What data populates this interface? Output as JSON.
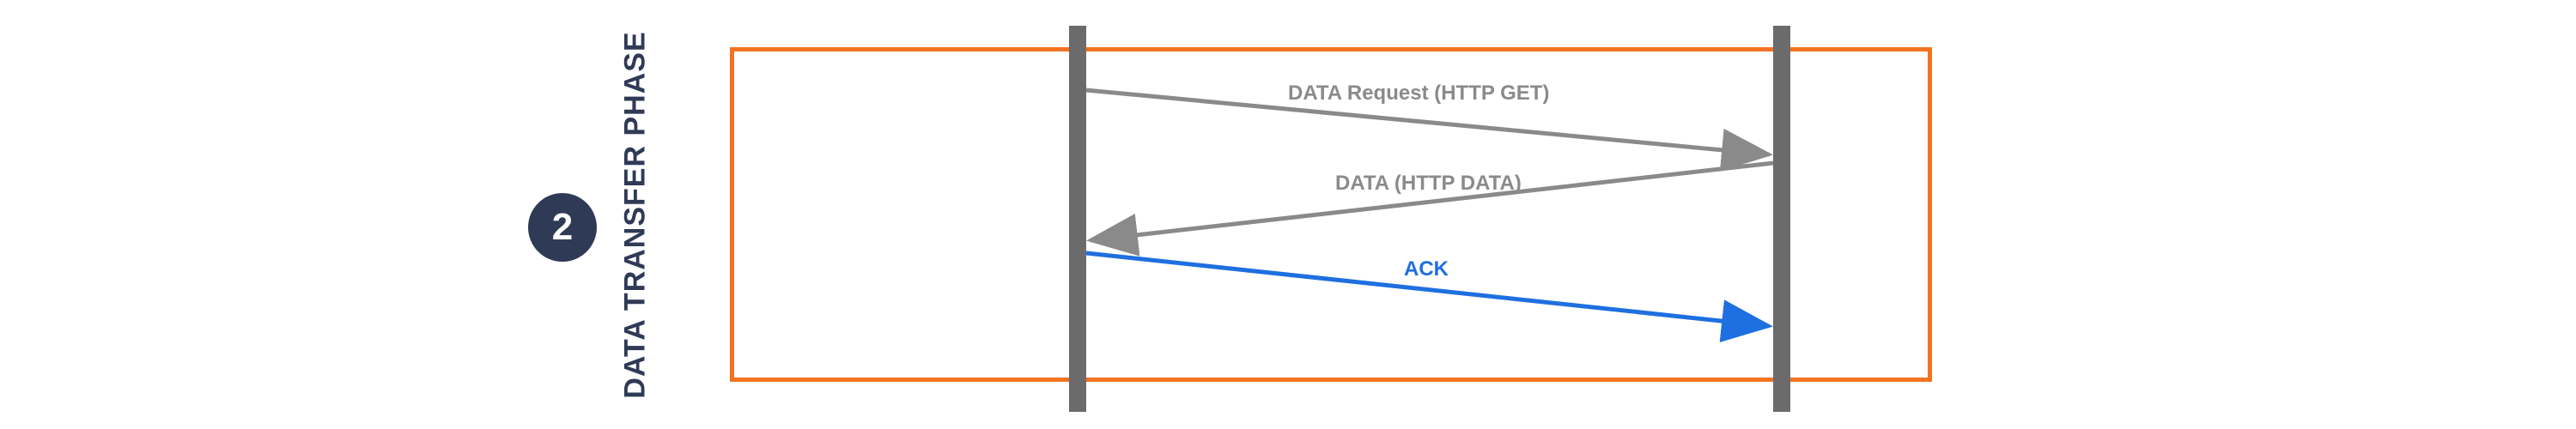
{
  "phase": {
    "number": "2",
    "title": "DATA TRANSFER PHASE"
  },
  "messages": {
    "req": "DATA Request (HTTP GET)",
    "resp": "DATA (HTTP DATA)",
    "ack": "ACK"
  },
  "colors": {
    "badge_bg": "#2F3A56",
    "panel_border": "#F37321",
    "lifeline": "#6B6B6B",
    "grey_arrow": "#8A8A8A",
    "blue_arrow": "#1E6FE0"
  },
  "chart_data": {
    "type": "sequence-diagram",
    "title": "DATA TRANSFER PHASE",
    "lifelines": [
      "left",
      "right"
    ],
    "messages": [
      {
        "from": "left",
        "to": "right",
        "label": "DATA Request (HTTP GET)",
        "color": "grey"
      },
      {
        "from": "right",
        "to": "left",
        "label": "DATA (HTTP DATA)",
        "color": "grey"
      },
      {
        "from": "left",
        "to": "right",
        "label": "ACK",
        "color": "blue"
      }
    ]
  }
}
